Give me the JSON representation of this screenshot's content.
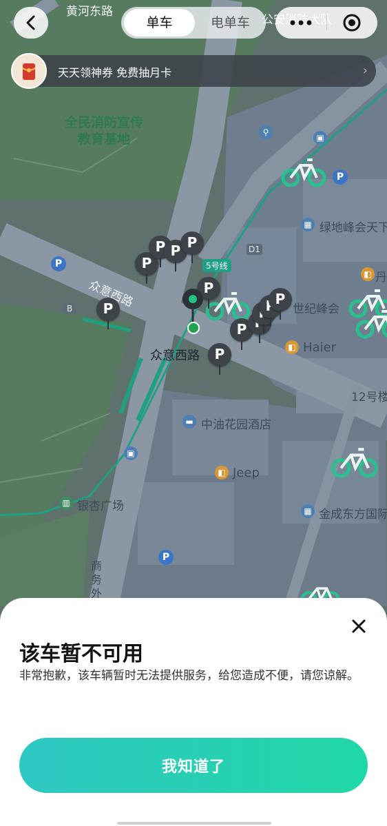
{
  "top_bar": {
    "back_icon": "chevron-left-icon",
    "tabs": [
      {
        "label": "单车",
        "active": true
      },
      {
        "label": "电单车",
        "active": false
      }
    ],
    "more_icon": "more-dots-icon",
    "target_icon": "circle-target-icon"
  },
  "promo": {
    "text": "天天领神券 免费抽月卡",
    "arrow": "›"
  },
  "map": {
    "labels": {
      "top_road": "黄河东路",
      "top_right": "公安消防大队",
      "park": "全民消防宣传\n教育基地",
      "lvdi": "绿地峰会天下",
      "line5": "5号线",
      "d1": "D1",
      "shiji": "世纪峰会",
      "road_zhongyi_w": "众意西路",
      "road_zhongyi": "众意西路",
      "haier": "Haier",
      "building12": "12号楼",
      "hotel": "中油花园酒店",
      "jeep": "Jeep",
      "ginkgo": "银杏广场",
      "jincheng": "金成东方国际",
      "shangwu": "商务外",
      "dan": "丹",
      "b": "B"
    },
    "parking_letter": "P"
  },
  "sheet": {
    "close_icon": "close-icon",
    "title": "该车暂不可用",
    "message": "非常抱歉，该车辆暂时无法提供服务，给您造成不便，请您谅解。",
    "button": "我知道了"
  },
  "colors": {
    "accent_start": "#2fc7c3",
    "accent_end": "#20d8a6",
    "bike_green": "#2bbf8f"
  }
}
